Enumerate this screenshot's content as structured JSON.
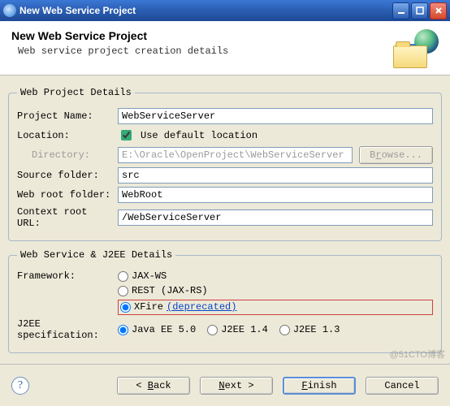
{
  "window": {
    "title": "New Web Service Project"
  },
  "header": {
    "title": "New Web Service Project",
    "subtitle": "Web service project creation details"
  },
  "group1": {
    "legend": "Web Project Details",
    "projectNameLabel": "Project Name:",
    "projectName": "WebServiceServer",
    "locationLabel": "Location:",
    "useDefaultLabel": "Use default location",
    "useDefaultChecked": true,
    "directoryLabel": "Directory:",
    "directory": "E:\\Oracle\\OpenProject\\WebServiceServer",
    "browseLabel": "Browse...",
    "sourceFolderLabel": "Source folder:",
    "sourceFolder": "src",
    "webRootLabel": "Web root folder:",
    "webRoot": "WebRoot",
    "contextRootLabel": "Context root URL:",
    "contextRoot": "/WebServiceServer"
  },
  "group2": {
    "legend": "Web Service & J2EE Details",
    "frameworkLabel": "Framework:",
    "options": {
      "jaxws": "JAX-WS",
      "rest": "REST (JAX-RS)",
      "xfire": "XFire",
      "xfireDeprecated": "(deprecated)"
    },
    "selectedFramework": "xfire",
    "j2eeLabel": "J2EE specification:",
    "j2ee": {
      "ee5": "Java EE 5.0",
      "j2ee14": "J2EE 1.4",
      "j2ee13": "J2EE 1.3"
    },
    "selectedJ2ee": "ee5"
  },
  "buttons": {
    "back": "< Back",
    "next": "Next >",
    "finish": "Finish",
    "cancel": "Cancel"
  },
  "watermark": "@51CTO博客"
}
